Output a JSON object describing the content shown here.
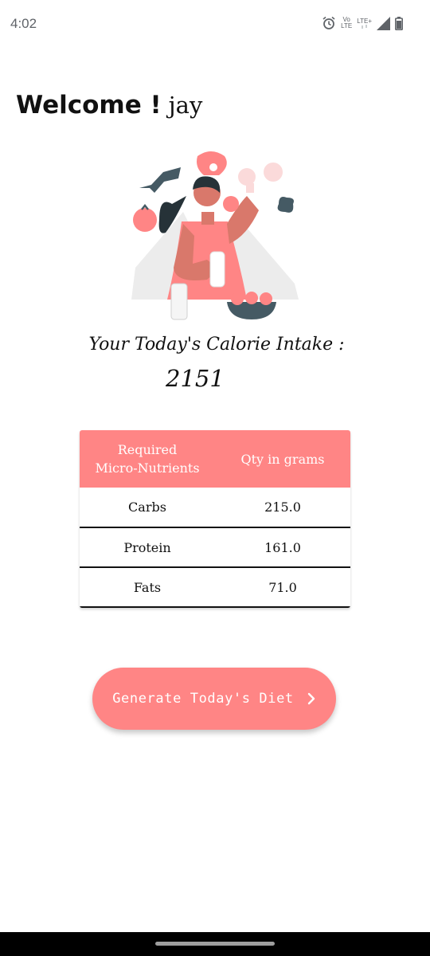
{
  "status_bar": {
    "time": "4:02",
    "volte_top": "Vo",
    "volte_bottom": "LTE",
    "network_label": "LTE+",
    "icons": [
      "alarm-icon",
      "volte-icon",
      "signal-icon",
      "battery-icon"
    ]
  },
  "header": {
    "welcome_label": "Welcome !",
    "user_name": "jay"
  },
  "illustration": {
    "icon": "chef-with-food-icon"
  },
  "calorie": {
    "label": "Your Today's Calorie Intake :",
    "value": "2151"
  },
  "table": {
    "headers": [
      "Required\nMicro-Nutrients",
      "Qty in grams"
    ],
    "rows": [
      {
        "nutrient": "Carbs",
        "qty": "215.0"
      },
      {
        "nutrient": "Protein",
        "qty": "161.0"
      },
      {
        "nutrient": "Fats",
        "qty": "71.0"
      }
    ]
  },
  "actions": {
    "generate_label": "Generate Today's Diet",
    "generate_icon": "chevron-right-icon"
  },
  "colors": {
    "accent": "#ff8585",
    "text": "#111111",
    "nav_bar": "#000000"
  }
}
